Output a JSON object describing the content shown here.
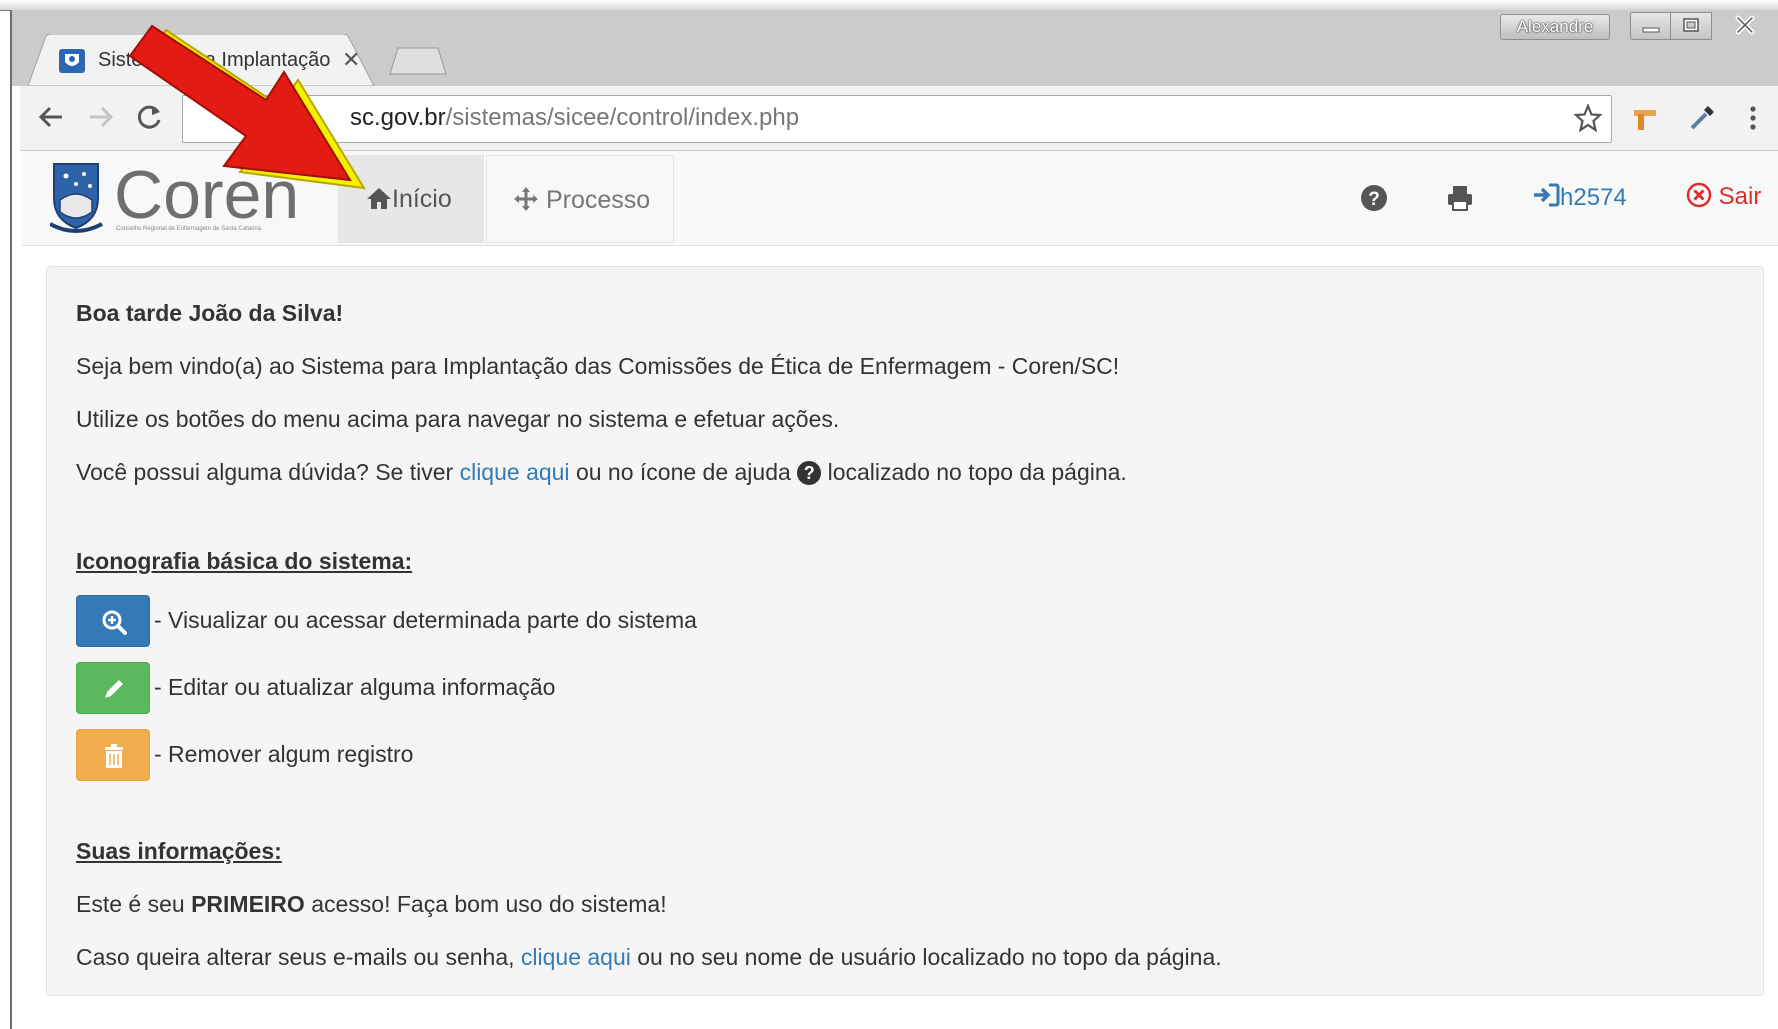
{
  "window": {
    "user": "Alexandre"
  },
  "browser": {
    "tab_title": "Sistema para Implantação",
    "url_host": "sc.gov.br",
    "url_path": "/sistemas/sicee/control/index.php",
    "icons": [
      "back-icon",
      "forward-icon",
      "reload-icon",
      "star-icon",
      "extension-icon",
      "eyedropper-icon",
      "menu-icon"
    ]
  },
  "nav": {
    "logo_text": "Coren",
    "logo_subtext": "Conselho Regional de Enfermagem de Santa Catarina",
    "home_label": "Início",
    "process_label": "Processo",
    "username": "h2574",
    "logout_label": "Sair"
  },
  "content": {
    "greeting": "Boa tarde João da Silva!",
    "welcome": "Seja bem vindo(a) ao Sistema para Implantação das Comissões de Ética de Enfermagem - Coren/SC!",
    "instructions": "Utilize os botões do menu acima para navegar no sistema e efetuar ações.",
    "question_pre": "Você possui alguma dúvida? Se tiver",
    "question_link": "clique aqui",
    "question_mid": "ou no ícone de ajuda",
    "question_post": "localizado no topo da página.",
    "icon_heading": "Iconografia básica do sistema:",
    "icon_view": "- Visualizar ou acessar determinada parte do sistema",
    "icon_edit": "- Editar ou atualizar alguma informação",
    "icon_remove": "- Remover algum registro",
    "info_heading": "Suas informações:",
    "access_pre": "Este é seu",
    "access_bold": "PRIMEIRO",
    "access_post": "acesso! Faça bom uso do sistema!",
    "change_pre": "Caso queira alterar seus e-mails ou senha,",
    "change_link": "clique aqui",
    "change_post": "ou no seu nome de usuário localizado no topo da página."
  },
  "colors": {
    "link": "#337ab7",
    "logout": "#d9302c",
    "view_button": "#337ab7",
    "edit_button": "#5cb85c",
    "remove_button": "#f0ad4e",
    "annotation_arrow": "#e31b12"
  }
}
